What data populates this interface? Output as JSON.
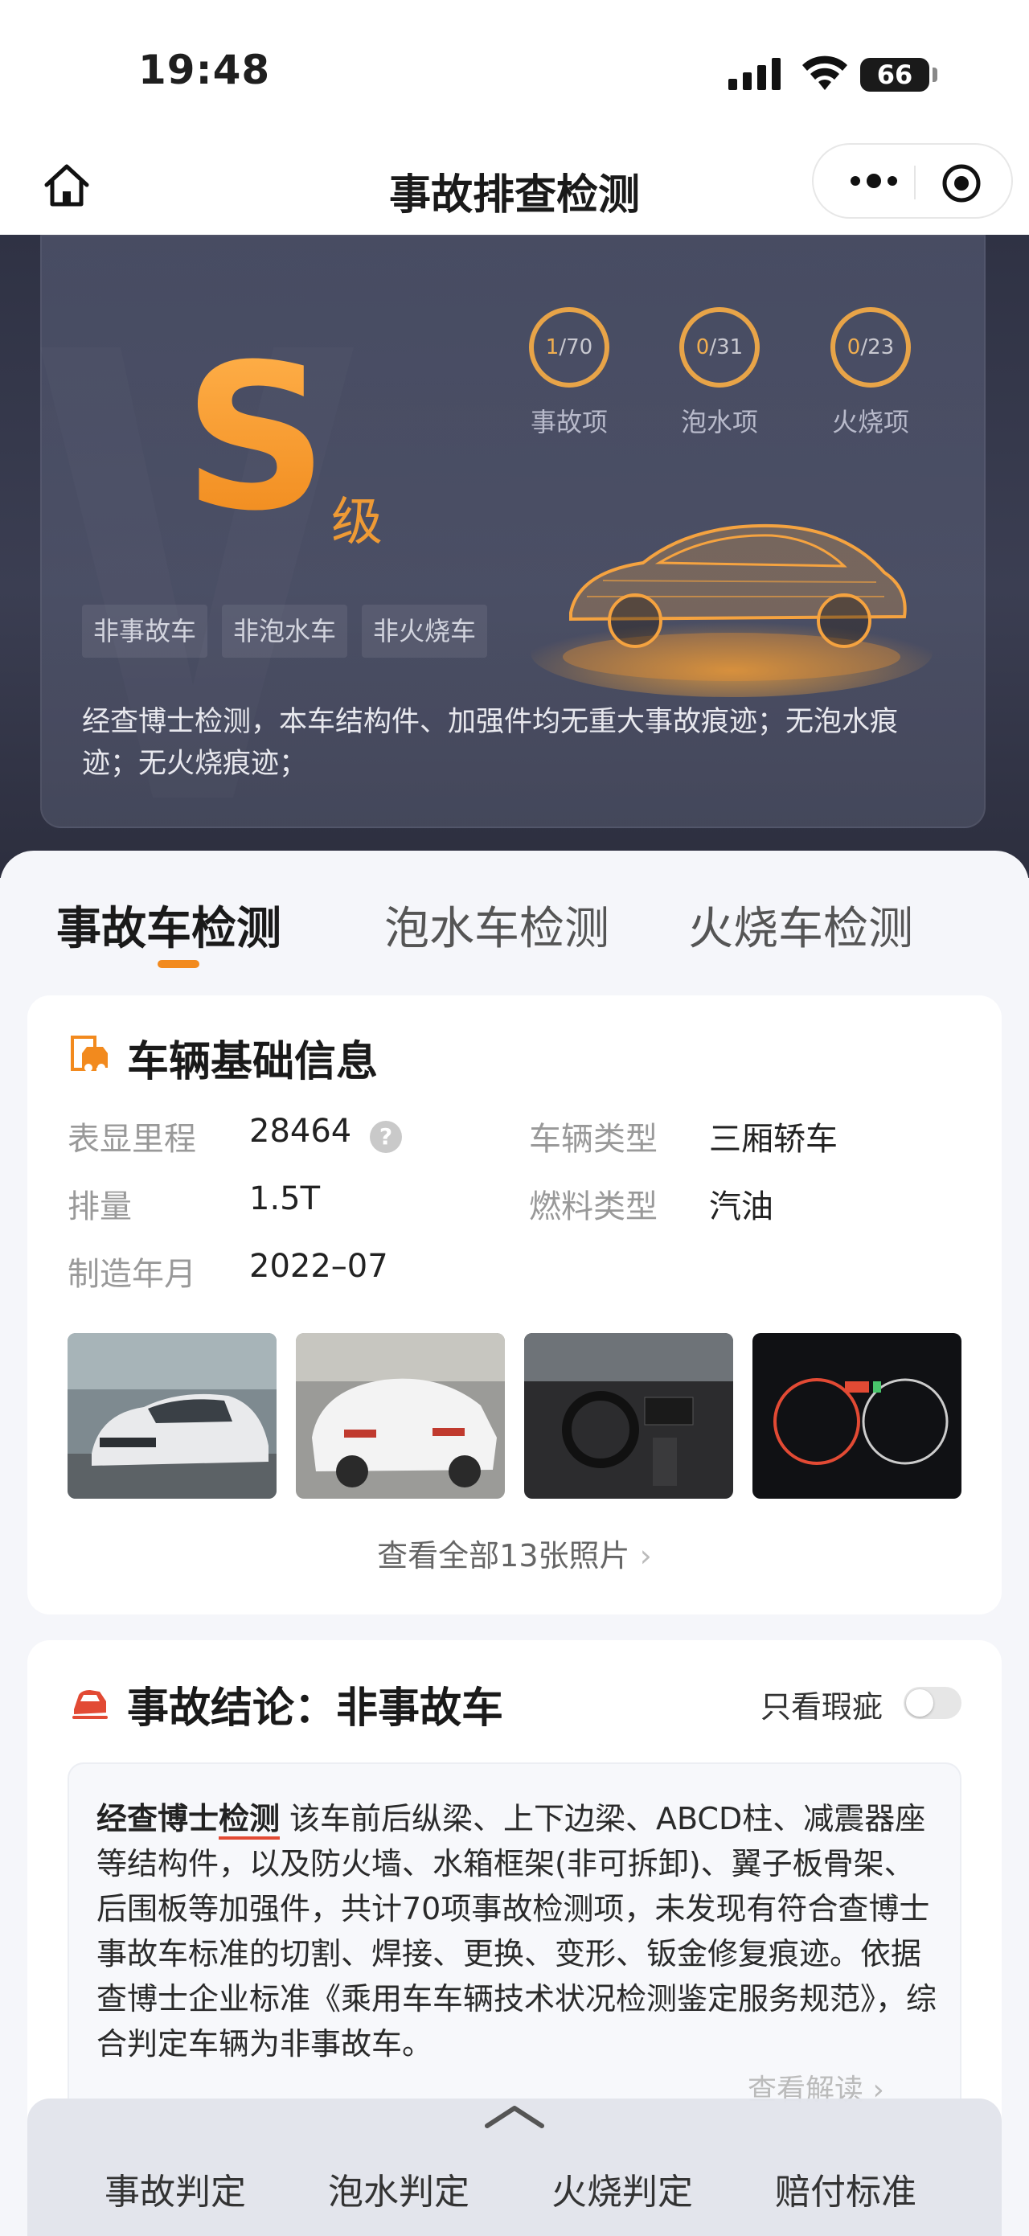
{
  "status_bar": {
    "time": "19:48",
    "battery": "66"
  },
  "navbar": {
    "title": "事故排查检测"
  },
  "hero": {
    "grade_letter": "S",
    "grade_suffix": "级",
    "rings": [
      {
        "value": "1",
        "total": "/70",
        "label": "事故项"
      },
      {
        "value": "0",
        "total": "/31",
        "label": "泡水项"
      },
      {
        "value": "0",
        "total": "/23",
        "label": "火烧项"
      }
    ],
    "tags": [
      "非事故车",
      "非泡水车",
      "非火烧车"
    ],
    "description": "经查博士检测，本车结构件、加强件均无重大事故痕迹；无泡水痕迹；无火烧痕迹；",
    "accent_color": "#f28a1e"
  },
  "tabs": [
    {
      "label": "事故车检测",
      "active": true
    },
    {
      "label": "泡水车检测",
      "active": false
    },
    {
      "label": "火烧车检测",
      "active": false
    }
  ],
  "basic_info": {
    "title": "车辆基础信息",
    "fields": {
      "mileage_label": "表显里程",
      "mileage_value": "28464",
      "vehicle_type_label": "车辆类型",
      "vehicle_type_value": "三厢轿车",
      "displacement_label": "排量",
      "displacement_value": "1.5T",
      "fuel_label": "燃料类型",
      "fuel_value": "汽油",
      "date_label": "制造年月",
      "date_value": "2022–07"
    },
    "photos": [
      "car-front-photo",
      "car-rear-photo",
      "car-interior-photo",
      "dashboard-photo"
    ],
    "view_all": "查看全部13张照片"
  },
  "conclusion": {
    "title": "事故结论：非事故车",
    "only_flaw_label": "只看瑕疵",
    "only_flaw_on": false,
    "brand_prefix": "经查博士",
    "brand_mark": "检测",
    "text": "该车前后纵梁、上下边梁、ABCD柱、减震器座等结构件，以及防火墙、水箱框架(非可拆卸)、翼子板骨架、后围板等加强件，共计70项事故检测项，未发现有符合查博士事故车标准的切割、焊接、更换、变形、钣金修复痕迹。依据查博士企业标准《乘用车车辆技术状况检测鉴定服务规范》，综合判定车辆为非事故车。",
    "read_more": "查看解读"
  },
  "bottom_nav": [
    "事故判定",
    "泡水判定",
    "火烧判定",
    "赔付标准"
  ]
}
